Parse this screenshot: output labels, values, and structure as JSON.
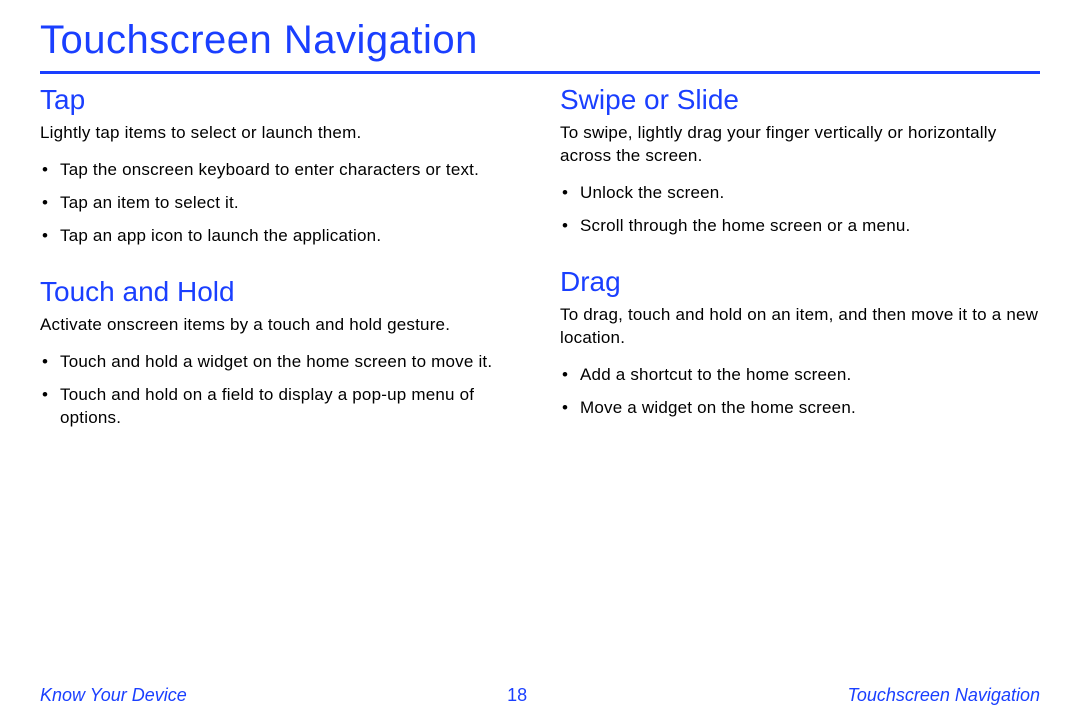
{
  "title": "Touchscreen Navigation",
  "left_column": {
    "sections": [
      {
        "heading": "Tap",
        "intro": "Lightly tap items to select or launch them.",
        "bullets": [
          "Tap the onscreen keyboard to enter characters or text.",
          "Tap an item to select it.",
          "Tap an app icon to launch the application."
        ]
      },
      {
        "heading": "Touch and Hold",
        "intro": "Activate onscreen items by a touch and hold gesture.",
        "bullets": [
          "Touch and hold a widget on the home screen to move it.",
          "Touch and hold on a field to display a pop-up menu of options."
        ]
      }
    ]
  },
  "right_column": {
    "sections": [
      {
        "heading": "Swipe or Slide",
        "intro": "To swipe, lightly drag your finger vertically or horizontally across the screen.",
        "bullets": [
          "Unlock the screen.",
          "Scroll through the home screen or a menu."
        ]
      },
      {
        "heading": "Drag",
        "intro": "To drag, touch and hold on an item, and then move it to a new location.",
        "bullets": [
          "Add a shortcut to the home screen.",
          "Move a widget on the home screen."
        ]
      }
    ]
  },
  "footer": {
    "left": "Know Your Device",
    "page_number": "18",
    "right": "Touchscreen Navigation"
  }
}
